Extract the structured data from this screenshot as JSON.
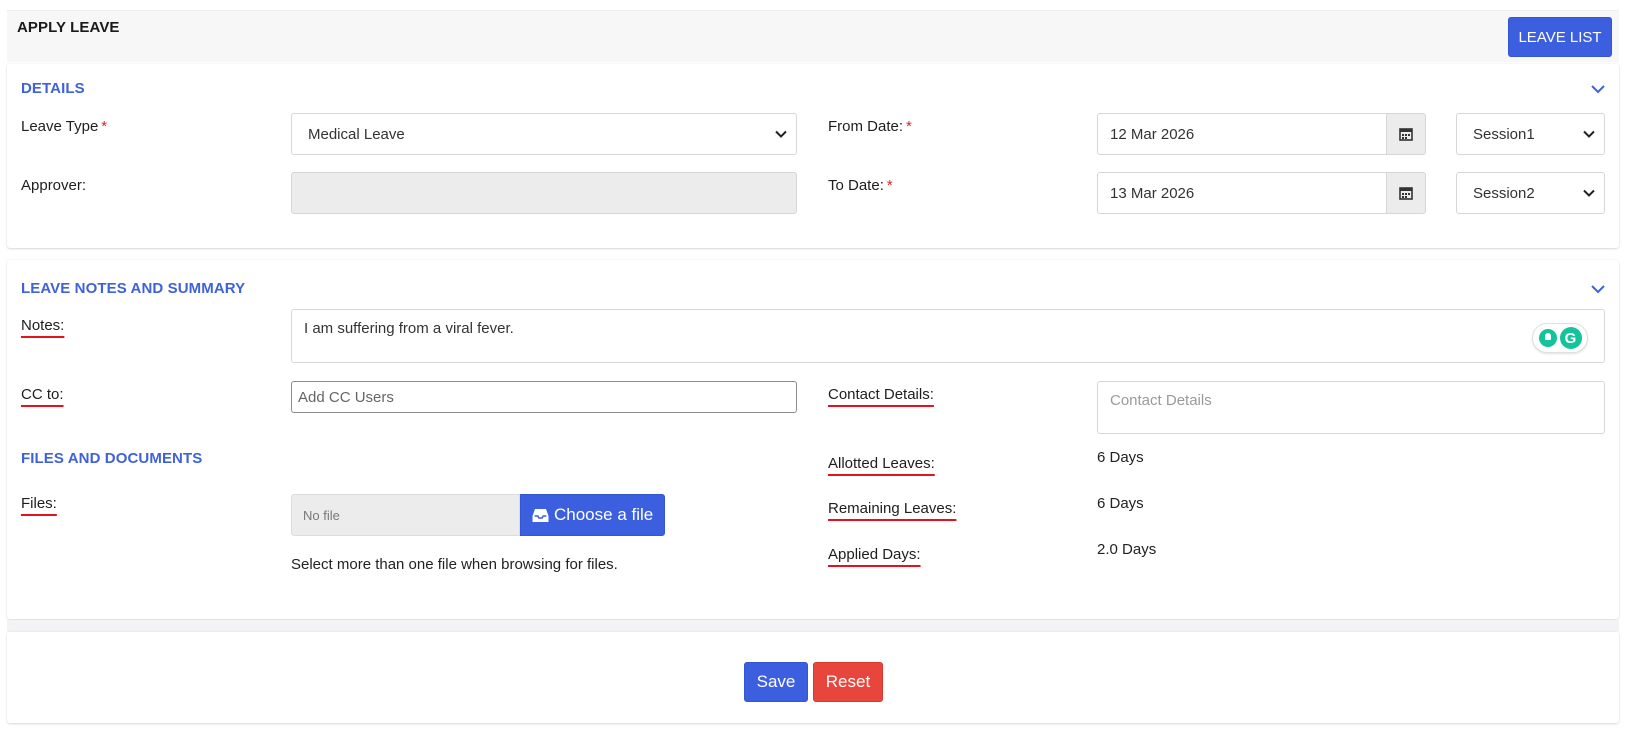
{
  "header": {
    "title": "APPLY LEAVE",
    "leave_list_label": "LEAVE LIST"
  },
  "details": {
    "section_title": "DETAILS",
    "leave_type_label": "Leave Type",
    "leave_type_value": "Medical Leave",
    "approver_label": "Approver:",
    "approver_value": "",
    "from_date_label": "From Date:",
    "from_date_value": "12 Mar 2026",
    "from_session": "Session1",
    "to_date_label": "To Date:",
    "to_date_value": "13 Mar 2026",
    "to_session": "Session2",
    "required_mark": "*"
  },
  "notes_summary": {
    "section_title": "LEAVE NOTES AND SUMMARY",
    "notes_label": "Notes:",
    "notes_value": "I am suffering from a viral fever.",
    "cc_label": "CC to:",
    "cc_placeholder": "Add CC Users",
    "contact_label": "Contact Details:",
    "contact_placeholder": "Contact Details",
    "files_section_title": "FILES AND DOCUMENTS",
    "files_label": "Files:",
    "file_status": "No file",
    "choose_file_label": "Choose a file",
    "file_helper": "Select more than one file when browsing for files.",
    "allotted_label": "Allotted Leaves:",
    "allotted_value": "6 Days",
    "remaining_label": "Remaining Leaves:",
    "remaining_value": "6 Days",
    "applied_label": "Applied Days:",
    "applied_value": "2.0 Days"
  },
  "actions": {
    "save_label": "Save",
    "reset_label": "Reset"
  },
  "colors": {
    "primary": "#3c5fe0",
    "danger": "#e8453c",
    "section_title": "#3f62d8",
    "required": "#e02020",
    "annotation_underline": "#e0141e",
    "grammarly": "#15c39a"
  },
  "icons": [
    "chevron-down-icon",
    "calendar-icon",
    "inbox-icon",
    "grammarly-icon",
    "lightbulb-icon"
  ]
}
